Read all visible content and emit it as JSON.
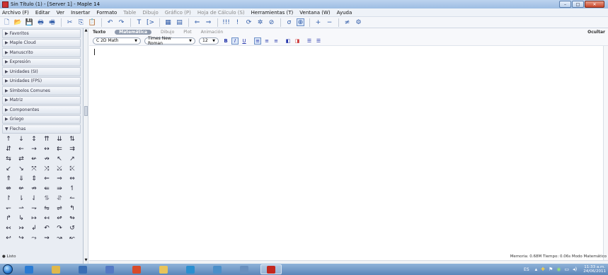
{
  "window": {
    "title": "Sin Título (1) - [Server 1] - Maple 14",
    "controls": [
      "–",
      "□",
      "✕"
    ]
  },
  "menubar": [
    {
      "label": "Archivo (F)",
      "enabled": true
    },
    {
      "label": "Editar",
      "enabled": true
    },
    {
      "label": "Ver",
      "enabled": true
    },
    {
      "label": "Insertar",
      "enabled": true
    },
    {
      "label": "Formato",
      "enabled": true
    },
    {
      "label": "Table",
      "enabled": false
    },
    {
      "label": "Dibujo",
      "enabled": false
    },
    {
      "label": "Gráfico (P)",
      "enabled": false
    },
    {
      "label": "Hoja de Cálculo (S)",
      "enabled": false
    },
    {
      "label": "Herramientas (T)",
      "enabled": true
    },
    {
      "label": "Ventana (W)",
      "enabled": true
    },
    {
      "label": "Ayuda",
      "enabled": true
    }
  ],
  "toolbar": {
    "buttons": [
      {
        "name": "new-document-button",
        "glyph": "🗋"
      },
      {
        "name": "open-button",
        "glyph": "📂"
      },
      {
        "name": "save-button",
        "glyph": "💾"
      },
      {
        "name": "print-button",
        "glyph": "🖶"
      },
      {
        "name": "print-preview-button",
        "glyph": "🖷"
      },
      {
        "name": "cut-button",
        "glyph": "✂"
      },
      {
        "name": "copy-button",
        "glyph": "⎘"
      },
      {
        "name": "paste-button",
        "glyph": "📋"
      },
      {
        "name": "undo-button",
        "glyph": "↶"
      },
      {
        "name": "redo-button",
        "glyph": "↷"
      },
      {
        "name": "text-mode-button",
        "glyph": "T"
      },
      {
        "name": "math-mode-button",
        "glyph": "[>"
      },
      {
        "name": "insert-table-button",
        "glyph": "▦"
      },
      {
        "name": "insert-section-button",
        "glyph": "▤"
      },
      {
        "name": "back-button",
        "glyph": "⇐"
      },
      {
        "name": "forward-button",
        "glyph": "⇒"
      },
      {
        "name": "execute-all-button",
        "glyph": "!!!"
      },
      {
        "name": "execute-button",
        "glyph": "!"
      },
      {
        "name": "restart-button",
        "glyph": "⟳"
      },
      {
        "name": "debug-button",
        "glyph": "✲"
      },
      {
        "name": "stop-button",
        "glyph": "⊘"
      },
      {
        "name": "help-button",
        "glyph": "σ"
      },
      {
        "name": "zoom-button",
        "glyph": "⊕"
      },
      {
        "name": "zoom-in-button",
        "glyph": "+"
      },
      {
        "name": "zoom-out-button",
        "glyph": "−"
      },
      {
        "name": "format-button",
        "glyph": "≠"
      },
      {
        "name": "properties-button",
        "glyph": "⚙"
      }
    ]
  },
  "palettes": [
    {
      "label": "Favoritos",
      "expanded": false
    },
    {
      "label": "Maple Cloud",
      "expanded": false
    },
    {
      "label": "Manuscrito",
      "expanded": false
    },
    {
      "label": "Expresión",
      "expanded": false
    },
    {
      "label": "Unidades (SI)",
      "expanded": false
    },
    {
      "label": "Unidades (FPS)",
      "expanded": false
    },
    {
      "label": "Símbolos Comunes",
      "expanded": false
    },
    {
      "label": "Matriz",
      "expanded": false
    },
    {
      "label": "Componentes",
      "expanded": false
    },
    {
      "label": "Griego",
      "expanded": false
    },
    {
      "label": "Flechas",
      "expanded": true
    }
  ],
  "arrows": [
    "↑",
    "↓",
    "↕",
    "⇈",
    "⇊",
    "⇅",
    "⇵",
    "←",
    "→",
    "↔",
    "⇇",
    "⇉",
    "⇆",
    "⇄",
    "↚",
    "↛",
    "↖",
    "↗",
    "↙",
    "↘",
    "⤧",
    "⤨",
    "⤩",
    "⤪",
    "⇑",
    "⇓",
    "⇕",
    "⇐",
    "⇒",
    "⇔",
    "⇎",
    "⇍",
    "⇏",
    "⇚",
    "⇛",
    "↿",
    "↾",
    "⇂",
    "⇃",
    "⥮",
    "⥯",
    "↼",
    "↽",
    "⇀",
    "⇁",
    "⇋",
    "⇌",
    "↰",
    "↱",
    "↳",
    "↦",
    "↤",
    "↫",
    "↬",
    "↢",
    "↣",
    "↲",
    "↶",
    "↷",
    "↺",
    "↩",
    "↪",
    "⤳",
    "⇝",
    "↝",
    "↜"
  ],
  "modetabs": [
    {
      "label": "Texto",
      "active": false,
      "dim": false
    },
    {
      "label": "Matemática",
      "active": true,
      "dim": false
    },
    {
      "label": "Dibujo",
      "active": false,
      "dim": true
    },
    {
      "label": "Plot",
      "active": false,
      "dim": true
    },
    {
      "label": "Animación",
      "active": false,
      "dim": true
    }
  ],
  "hide_label": "Ocultar",
  "format": {
    "style": "C 2D Math",
    "font": "Times New Roman",
    "size": "12",
    "bold": "B",
    "italic": "I",
    "underline": "U"
  },
  "status": {
    "left": "● Listo",
    "right": "Memoria: 0.68M   Tiempo: 0.06s   Modo Matemático"
  },
  "taskbar": {
    "language": "ES",
    "time": "11:33 a.m.",
    "date": "24/06/2011",
    "apps": [
      {
        "name": "ie",
        "color": "#2a7bd3"
      },
      {
        "name": "explorer",
        "color": "#e0b84b"
      },
      {
        "name": "media",
        "color": "#3a6fb5"
      },
      {
        "name": "mail",
        "color": "#5479c4"
      },
      {
        "name": "messenger",
        "color": "#d84b2a"
      },
      {
        "name": "folder",
        "color": "#e8c45a"
      },
      {
        "name": "network",
        "color": "#2a8fd0"
      },
      {
        "name": "paint",
        "color": "#4b8fc9"
      },
      {
        "name": "calculator",
        "color": "#6a90be"
      },
      {
        "name": "maple",
        "color": "#c3281f"
      }
    ]
  }
}
